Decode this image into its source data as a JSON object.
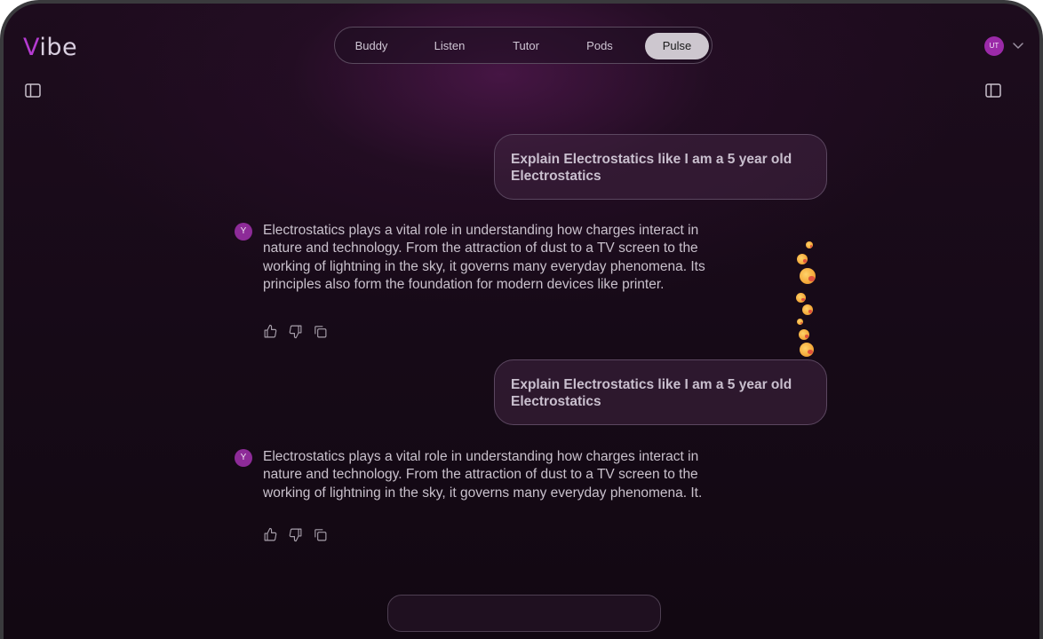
{
  "app": {
    "logo_prefix": "V",
    "logo_rest": "ibe"
  },
  "tabs": [
    {
      "label": "Buddy",
      "active": false
    },
    {
      "label": "Listen",
      "active": false
    },
    {
      "label": "Tutor",
      "active": false
    },
    {
      "label": "Pods",
      "active": false
    },
    {
      "label": "Pulse",
      "active": true
    }
  ],
  "user": {
    "initials": "UT",
    "avatar_color": "#9b2aa8"
  },
  "assistant": {
    "badge": "Y",
    "badge_color": "#8d2b98"
  },
  "messages": [
    {
      "role": "user",
      "text": "Explain Electrostatics like I am a 5 year old Electrostatics"
    },
    {
      "role": "assistant",
      "text": "Electrostatics plays a vital role in understanding how charges interact in nature and technology. From the attraction of dust to a TV screen to the working of lightning in the sky, it governs many everyday phenomena. Its principles also form the foundation for modern devices like printer."
    },
    {
      "role": "user",
      "text": "Explain Electrostatics like I am a 5 year old Electrostatics"
    },
    {
      "role": "assistant",
      "text": "Electrostatics plays a vital role in understanding how charges interact in nature and technology. From the attraction of dust to a TV screen to the working of lightning in the sky, it governs many everyday phenomena. It."
    }
  ],
  "icons": {
    "like": "thumbs-up-icon",
    "dislike": "thumbs-down-icon",
    "copy": "copy-icon",
    "sidebar_toggle": "sidebar-panel-icon",
    "dropdown": "chevron-down-icon",
    "reaction": "smiling-face-with-hearts-emoji"
  },
  "colors": {
    "accent": "#b53bd1",
    "background": "#170a18",
    "active_tab": "#cdc7cf"
  }
}
